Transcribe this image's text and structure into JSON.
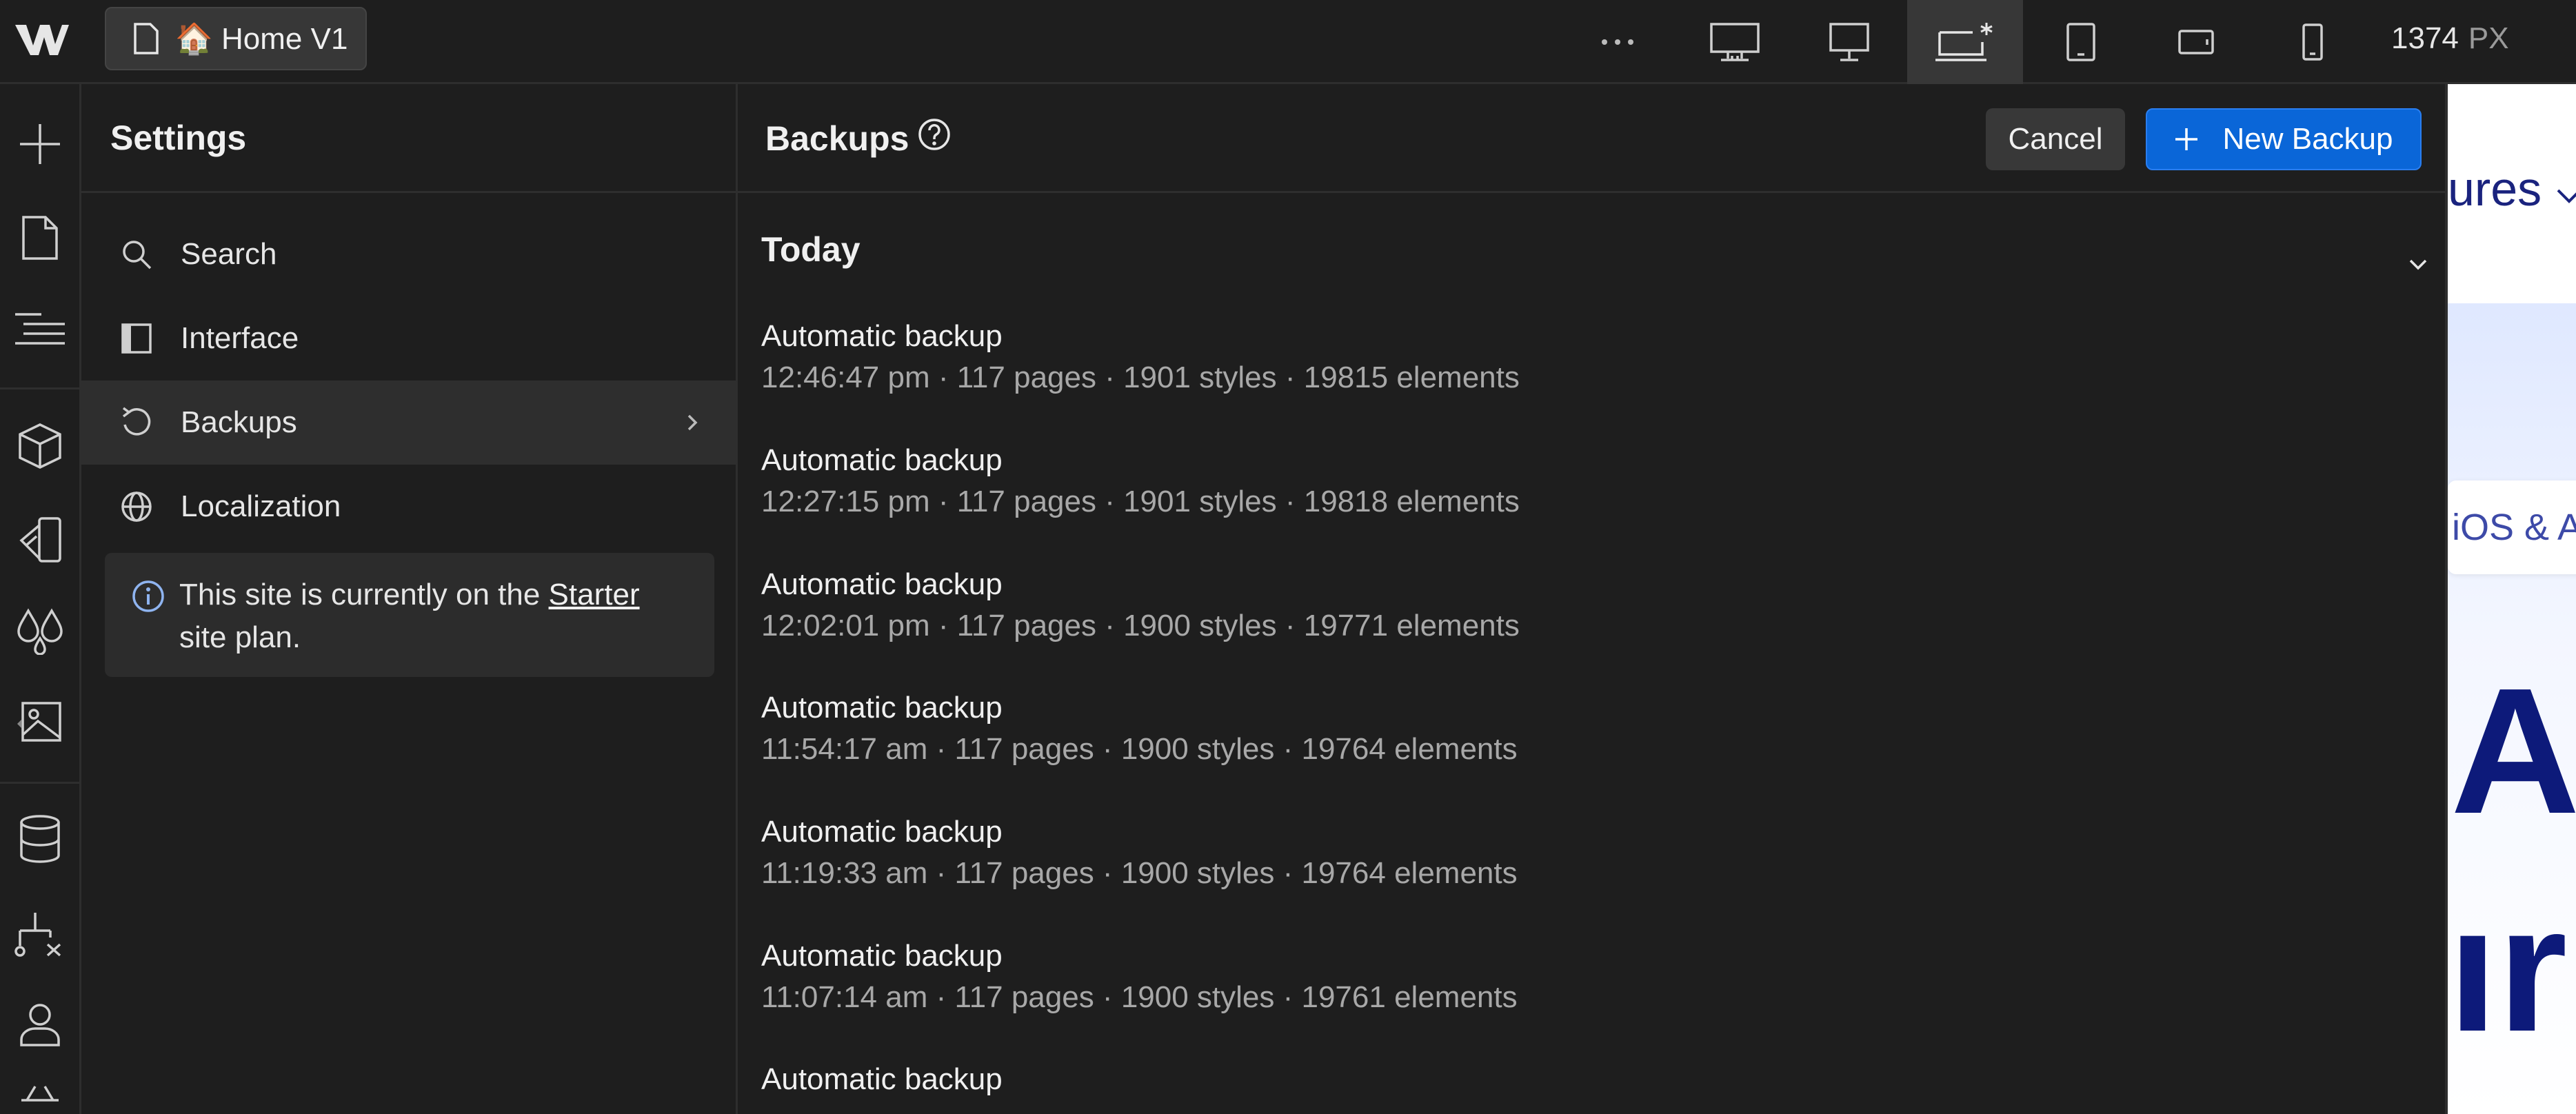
{
  "topbar": {
    "page_name": "🏠 Home V1",
    "width_value": "1374",
    "width_unit": "PX"
  },
  "settings": {
    "title": "Settings",
    "nav": [
      {
        "label": "Search",
        "icon": "search-icon"
      },
      {
        "label": "Interface",
        "icon": "panel-icon"
      },
      {
        "label": "Backups",
        "icon": "history-icon"
      },
      {
        "label": "Localization",
        "icon": "globe-icon"
      }
    ],
    "plan_notice": {
      "prefix": "This site is currently on the ",
      "link": "Starter",
      "suffix": "site plan."
    }
  },
  "backups": {
    "title": "Backups",
    "cancel_label": "Cancel",
    "new_label": "New Backup",
    "group_label": "Today",
    "items": [
      {
        "name": "Automatic backup",
        "meta": "12:46:47 pm · 117 pages · 1901 styles · 19815 elements"
      },
      {
        "name": "Automatic backup",
        "meta": "12:27:15 pm · 117 pages · 1901 styles · 19818 elements"
      },
      {
        "name": "Automatic backup",
        "meta": "12:02:01 pm · 117 pages · 1900 styles · 19771 elements"
      },
      {
        "name": "Automatic backup",
        "meta": "11:54:17 am · 117 pages · 1900 styles · 19764 elements"
      },
      {
        "name": "Automatic backup",
        "meta": "11:19:33 am · 117 pages · 1900 styles · 19764 elements"
      },
      {
        "name": "Automatic backup",
        "meta": "11:07:14 am · 117 pages · 1900 styles · 19761 elements"
      },
      {
        "name": "Automatic backup",
        "meta": ""
      }
    ]
  },
  "canvas": {
    "nav_fragment": "ures",
    "badge_fragment": "iOS & A",
    "headline_line1": "A",
    "headline_line2": "ır"
  },
  "colors": {
    "accent": "#0a66d8",
    "panel_bg": "#1e1e1e",
    "canvas_heading": "#0d1a7a"
  }
}
